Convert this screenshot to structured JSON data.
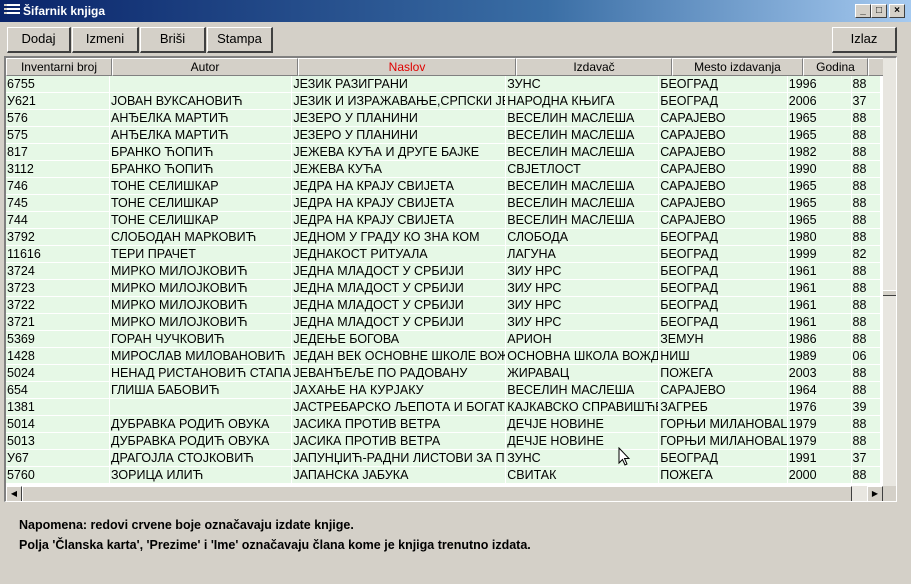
{
  "window": {
    "title": "Šifarnik knjiga"
  },
  "toolbar": {
    "add_label": "Dodaj",
    "edit_label": "Izmeni",
    "delete_label": "Briši",
    "print_label": "Stampa",
    "exit_label": "Izlaz"
  },
  "table": {
    "headers": [
      "Inventarni broj",
      "Autor",
      "Naslov",
      "Izdavač",
      "Mesto izdavanja",
      "Godina",
      ""
    ],
    "sorted_column": "Naslov",
    "sorted_color": "#e00000",
    "row_color": "#e6f8e6",
    "rows": [
      [
        "6755",
        "",
        "ЈЕЗИК РАЗИГРАНИ",
        "ЗУНС",
        "БЕОГРАД",
        "1996",
        "88"
      ],
      [
        "У621",
        "ЈОВАН ВУКСАНОВИЋ",
        "ЈЕЗИК И ИЗРАЖАВАЊЕ,СРПСКИ ЈЕЗИК",
        "НАРОДНА КЊИГА",
        "БЕОГРАД",
        "2006",
        "37"
      ],
      [
        "576",
        "АНЂЕЛКА МАРТИЋ",
        "ЈЕЗЕРО У ПЛАНИНИ",
        "ВЕСЕЛИН МАСЛЕША",
        "САРАЈЕВО",
        "1965",
        "88"
      ],
      [
        "575",
        "АНЂЕЛКА МАРТИЋ",
        "ЈЕЗЕРО У ПЛАНИНИ",
        "ВЕСЕЛИН МАСЛЕША",
        "САРАЈЕВО",
        "1965",
        "88"
      ],
      [
        "817",
        "БРАНКО ЋОПИЋ",
        "ЈЕЖЕВА КУЋА И ДРУГЕ БАЈКЕ",
        "ВЕСЕЛИН МАСЛЕША",
        "САРАЈЕВО",
        "1982",
        "88"
      ],
      [
        "3112",
        "БРАНКО ЋОПИЋ",
        "ЈЕЖЕВА КУЋА",
        "СВЈЕТЛОСТ",
        "САРАЈЕВО",
        "1990",
        "88"
      ],
      [
        "746",
        "ТОНЕ СЕЛИШКАР",
        "ЈЕДРА НА КРАЈУ СВИЈЕТА",
        "ВЕСЕЛИН МАСЛЕША",
        "САРАЈЕВО",
        "1965",
        "88"
      ],
      [
        "745",
        "ТОНЕ СЕЛИШКАР",
        "ЈЕДРА НА КРАЈУ СВИЈЕТА",
        "ВЕСЕЛИН МАСЛЕША",
        "САРАЈЕВО",
        "1965",
        "88"
      ],
      [
        "744",
        "ТОНЕ СЕЛИШКАР",
        "ЈЕДРА НА КРАЈУ СВИЈЕТА",
        "ВЕСЕЛИН МАСЛЕША",
        "САРАЈЕВО",
        "1965",
        "88"
      ],
      [
        "3792",
        "СЛОБОДАН МАРКОВИЋ",
        "ЈЕДНОМ У ГРАДУ КО ЗНА КОМ",
        "СЛОБОДА",
        "БЕОГРАД",
        "1980",
        "88"
      ],
      [
        "11616",
        "ТЕРИ ПРАЧЕТ",
        "ЈЕДНАКОСТ РИТУАЛА",
        "ЛАГУНА",
        "БЕОГРАД",
        "1999",
        "82"
      ],
      [
        "3724",
        "МИРКО МИЛОЈКОВИЋ",
        "ЈЕДНА МЛАДОСТ У СРБИЈИ",
        "ЗИУ НРС",
        "БЕОГРАД",
        "1961",
        "88"
      ],
      [
        "3723",
        "МИРКО МИЛОЈКОВИЋ",
        "ЈЕДНА МЛАДОСТ У СРБИЈИ",
        "ЗИУ НРС",
        "БЕОГРАД",
        "1961",
        "88"
      ],
      [
        "3722",
        "МИРКО МИЛОЈКОВИЋ",
        "ЈЕДНА МЛАДОСТ У СРБИЈИ",
        "ЗИУ НРС",
        "БЕОГРАД",
        "1961",
        "88"
      ],
      [
        "3721",
        "МИРКО МИЛОЈКОВИЋ",
        "ЈЕДНА МЛАДОСТ У СРБИЈИ",
        "ЗИУ НРС",
        "БЕОГРАД",
        "1961",
        "88"
      ],
      [
        "5369",
        "ГОРАН ЧУЧКОВИЋ",
        "ЈЕДЕЊЕ БОГОВА",
        "АРИОН",
        "ЗЕМУН",
        "1986",
        "88"
      ],
      [
        "1428",
        "МИРОСЛАВ МИЛОВАНОВИЋ",
        "ЈЕДАН ВЕК ОСНОВНЕ ШКОЛЕ ВОЖДОВАЦ",
        "ОСНОВНА ШКОЛА ВОЖДОВАЦ",
        "НИШ",
        "1989",
        "06"
      ],
      [
        "5024",
        "НЕНАД РИСТАНОВИЋ СТАПАРСКИ",
        "ЈЕВАНЂЕЉЕ ПО РАДОВАНУ",
        "ЖИРАВАЦ",
        "ПОЖЕГА",
        "2003",
        "88"
      ],
      [
        "654",
        "ГЛИША БАБОВИЋ",
        "ЈАХАЊЕ НА КУРЈАКУ",
        "ВЕСЕЛИН МАСЛЕША",
        "САРАЈЕВО",
        "1964",
        "88"
      ],
      [
        "1381",
        "",
        "ЈАСТРЕБАРСКО ЉЕПОТА И БОГАТСТВО",
        "КАЈКАВСКО СПРАВИШЋЕ",
        "ЗАГРЕБ",
        "1976",
        "39"
      ],
      [
        "5014",
        "ДУБРАВКА РОДИЋ ОВУКА",
        "ЈАСИКА ПРОТИВ ВЕТРА",
        "ДЕЧЈЕ НОВИНЕ",
        "ГОРЊИ МИЛАНОВАЦ",
        "1979",
        "88"
      ],
      [
        "5013",
        "ДУБРАВКА РОДИЋ ОВУКА",
        "ЈАСИКА ПРОТИВ ВЕТРА",
        "ДЕЧЈЕ НОВИНЕ",
        "ГОРЊИ МИЛАНОВАЦ",
        "1979",
        "88"
      ],
      [
        "У67",
        "ДРАГОЈЛА СТОЈКОВИЋ",
        "ЈАПУНЏИЋ-РАДНИ ЛИСТОВИ ЗА ПРВИ РАЗРЕД",
        "ЗУНС",
        "БЕОГРАД",
        "1991",
        "37"
      ],
      [
        "5760",
        "ЗОРИЦА ИЛИЋ",
        "ЈАПАНСКА ЈАБУКА",
        "СВИТАК",
        "ПОЖЕГА",
        "2000",
        "88"
      ]
    ]
  },
  "notes": {
    "line1": "Napomena: redovi crvene boje označavaju izdate knjige.",
    "line2": "Polja 'Članska karta', 'Prezime' i 'Ime' označavaju člana kome je knjiga trenutno izdata."
  }
}
